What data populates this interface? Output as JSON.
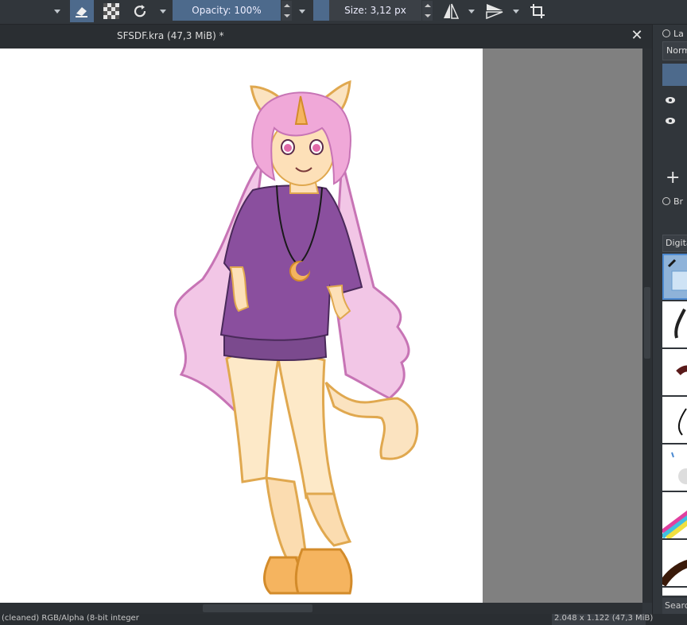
{
  "toolbar": {
    "eraser_icon": "eraser-icon",
    "alpha_icon": "checker-icon",
    "reload_icon": "reload-icon",
    "opacity_label": "Opacity: 100%",
    "size_label": "Size: 3,12 px",
    "mirror_h_icon": "mirror-horizontal-icon",
    "mirror_v_icon": "mirror-vertical-icon",
    "crop_icon": "crop-icon"
  },
  "document": {
    "title": "SFSDF.kra (47,3 MiB) *",
    "close_label": "✕"
  },
  "status": {
    "left_text": "(cleaned) RGB/Alpha (8-bit integer",
    "right_text": "2.048 x 1.122 (47,3 MiB)"
  },
  "layers_docker": {
    "title": "La",
    "blend_mode": "Normal"
  },
  "brushes_docker": {
    "title": "Br",
    "category": "Digital",
    "search_placeholder": "Search"
  },
  "colors": {
    "accent": "#4d6a8c",
    "panel": "#31363b",
    "canvas_bg": "#808080"
  }
}
